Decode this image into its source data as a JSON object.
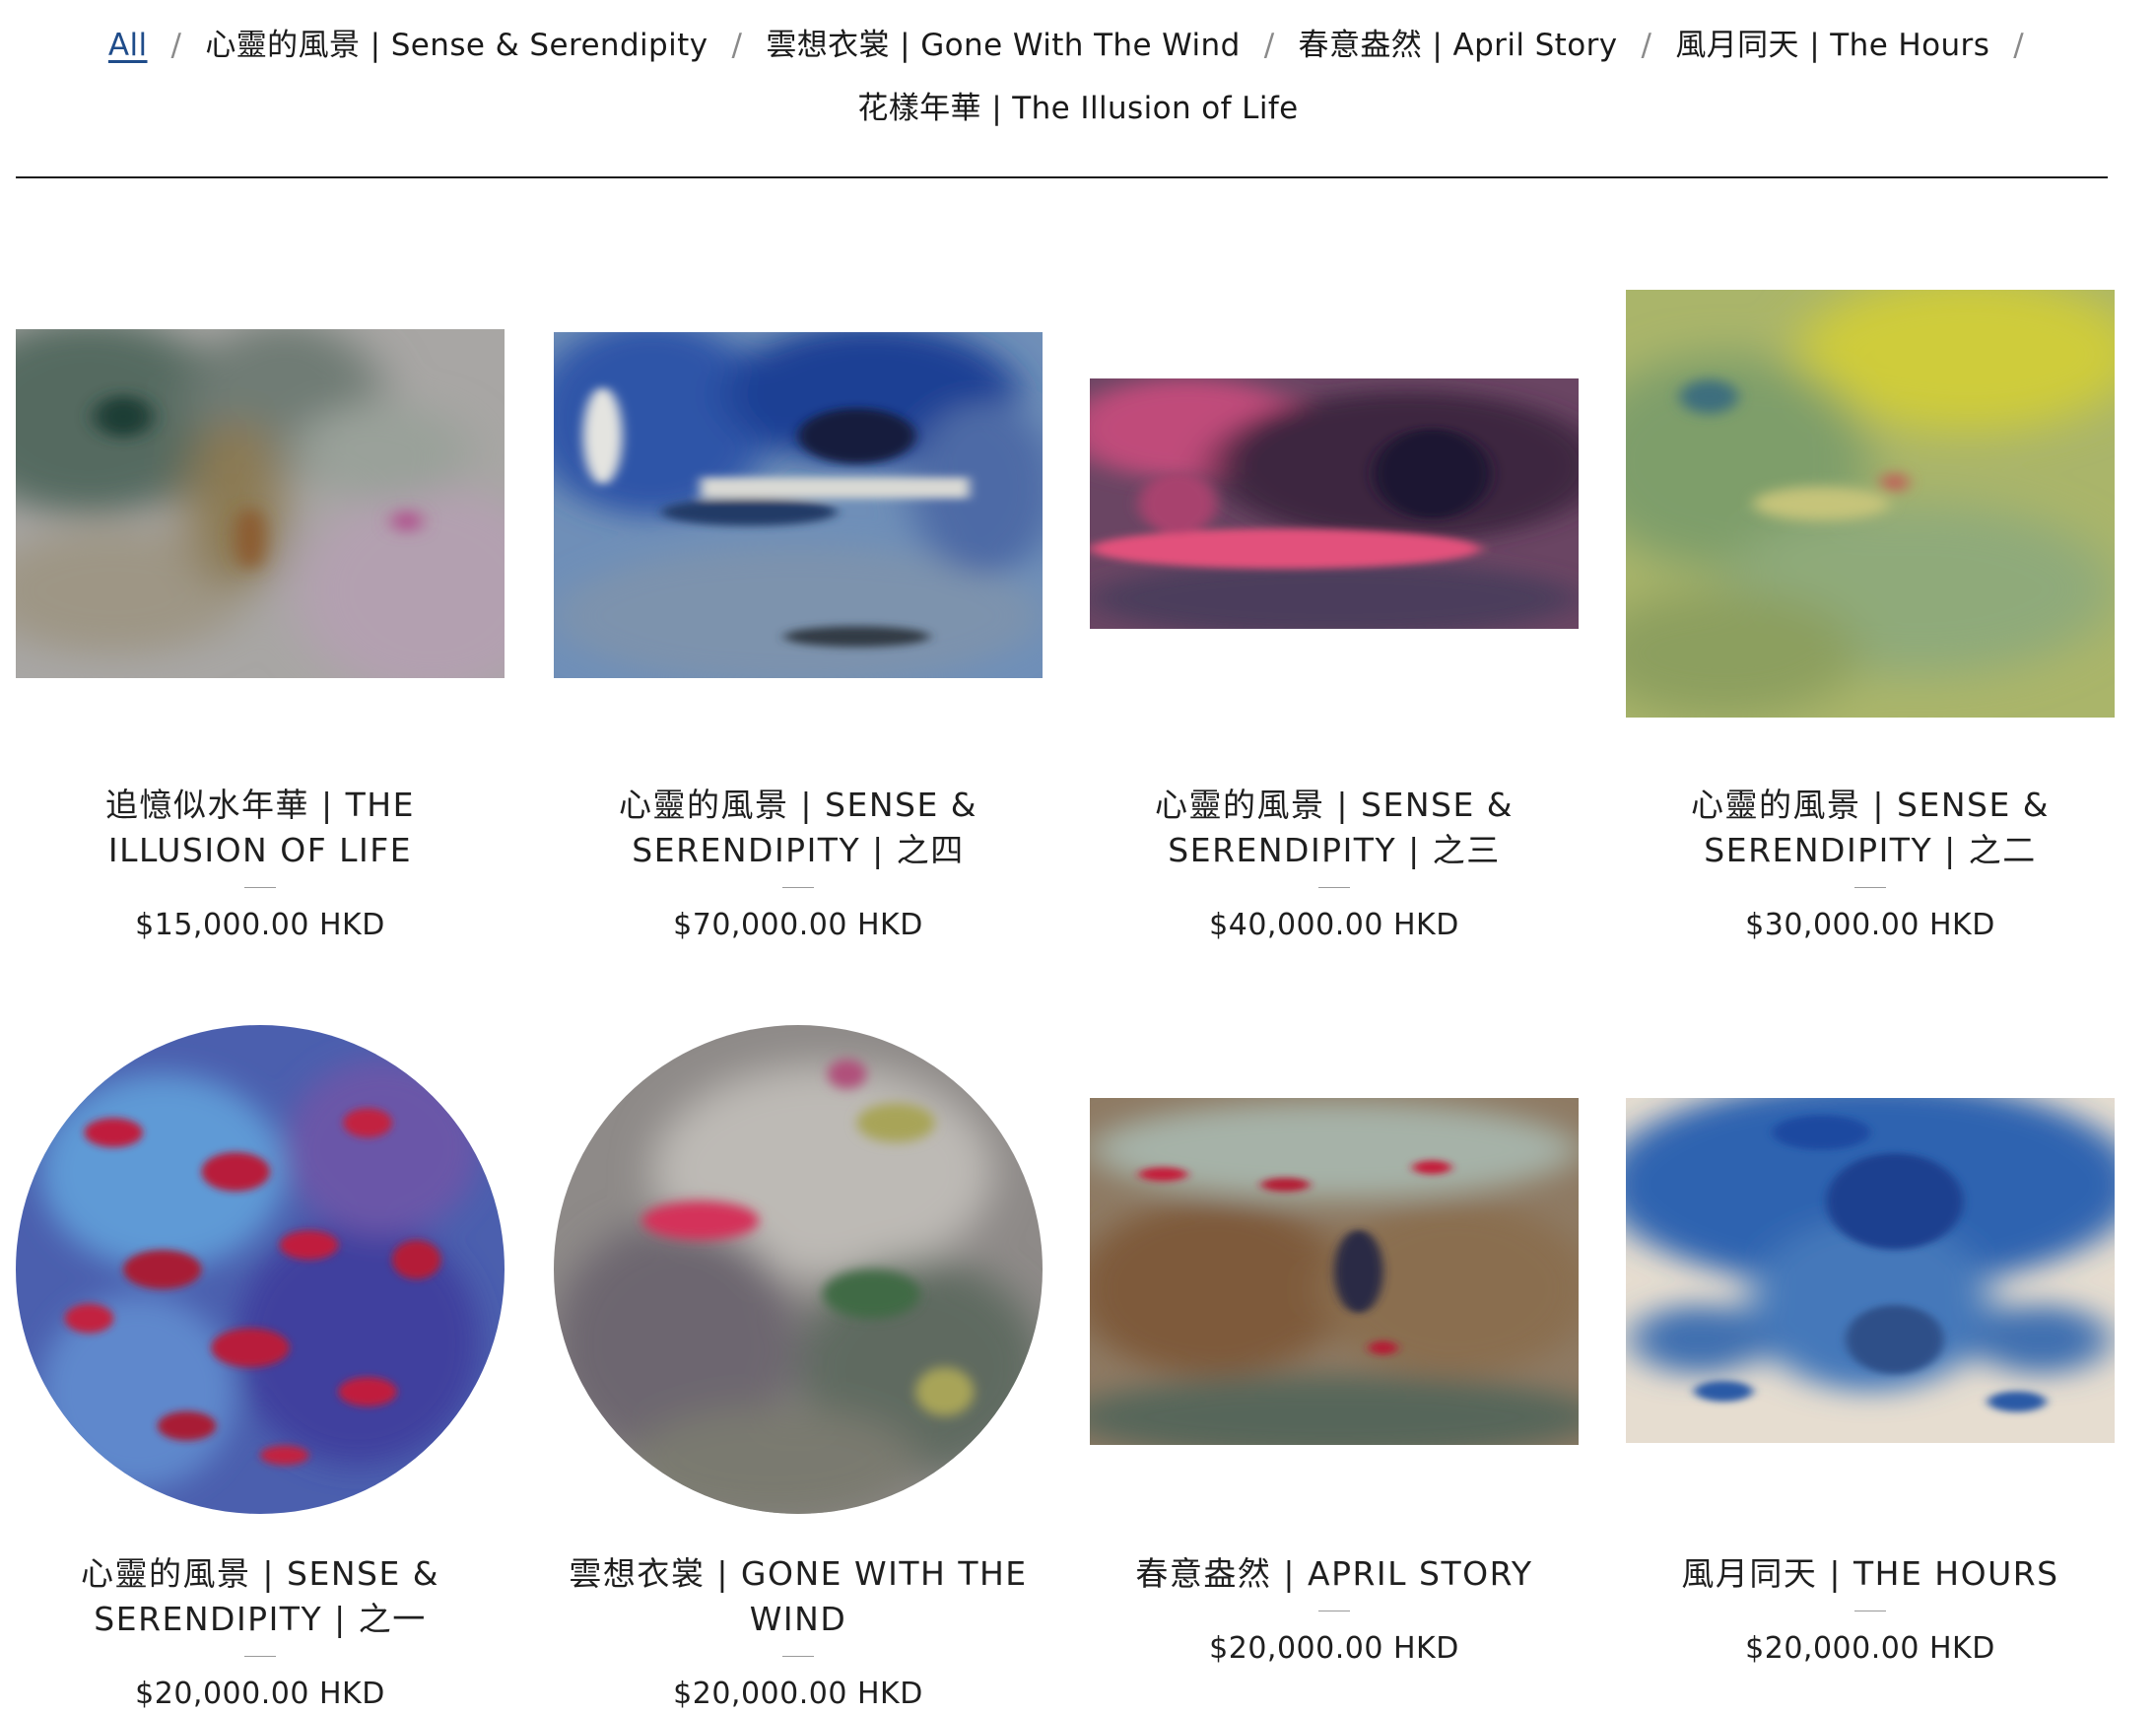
{
  "filters": [
    {
      "label": "All",
      "active": true
    },
    {
      "label": "心靈的風景 | Sense & Serendipity"
    },
    {
      "label": "雲想衣裳 | Gone With The Wind"
    },
    {
      "label": "春意盎然 | April Story"
    },
    {
      "label": "風月同天 | The Hours"
    },
    {
      "label": "花樣年華 | The Illusion of Life"
    }
  ],
  "separator": "/",
  "products": [
    {
      "title": "追憶似水年華 | The Illusion of Life",
      "price": "$15,000.00 HKD"
    },
    {
      "title": "心靈的風景 | Sense & Serendipity | 之四",
      "price": "$70,000.00 HKD"
    },
    {
      "title": "心靈的風景 | Sense & Serendipity | 之三",
      "price": "$40,000.00 HKD"
    },
    {
      "title": "心靈的風景 | Sense & Serendipity | 之二",
      "price": "$30,000.00 HKD"
    },
    {
      "title": "心靈的風景 | Sense & Serendipity | 之一",
      "price": "$20,000.00 HKD"
    },
    {
      "title": "雲想衣裳 | Gone With The Wind",
      "price": "$20,000.00 HKD"
    },
    {
      "title": "春意盎然 | April Story",
      "price": "$20,000.00 HKD"
    },
    {
      "title": "風月同天 | The Hours",
      "price": "$20,000.00 HKD"
    }
  ],
  "colors": {
    "active_link": "#1f4c8a",
    "text": "#1a1a1a",
    "divider": "#1a1a1a"
  }
}
